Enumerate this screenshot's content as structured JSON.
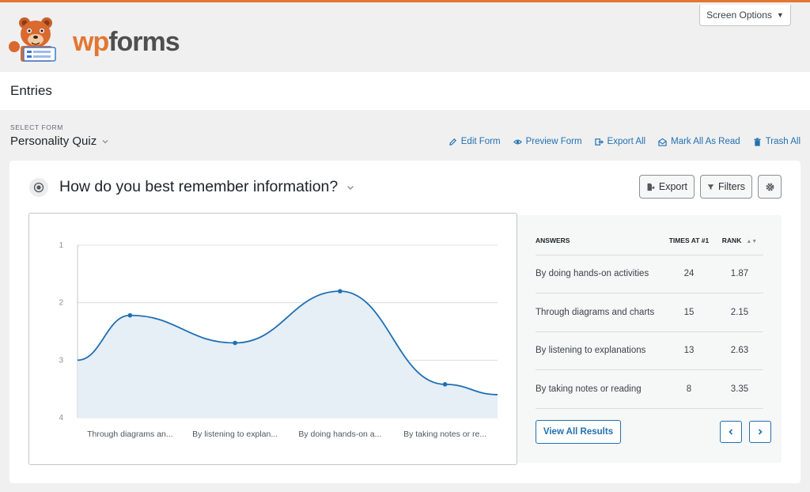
{
  "brand": {
    "wp": "wp",
    "forms": "forms",
    "accent": "#e27730"
  },
  "screen_options": {
    "label": "Screen Options",
    "caret": "▼"
  },
  "page": {
    "title": "Entries"
  },
  "select_form": {
    "label": "SELECT FORM",
    "value": "Personality Quiz"
  },
  "actions": [
    {
      "label": "Edit Form",
      "icon": "pencil-icon"
    },
    {
      "label": "Preview Form",
      "icon": "eye-icon"
    },
    {
      "label": "Export All",
      "icon": "export-icon"
    },
    {
      "label": "Mark All As Read",
      "icon": "envelope-open-icon"
    },
    {
      "label": "Trash All",
      "icon": "trash-icon"
    }
  ],
  "question": {
    "title": "How do you best remember information?"
  },
  "toolbar": {
    "export": "Export",
    "filters": "Filters"
  },
  "chart_data": {
    "type": "area",
    "categories": [
      "Through diagrams an...",
      "By listening to explan...",
      "By doing hands-on a...",
      "By taking notes or re..."
    ],
    "values": [
      2.22,
      2.7,
      1.8,
      3.42
    ],
    "start_value": 3.0,
    "end_value": 3.6,
    "y_ticks": [
      "1",
      "2",
      "3",
      "4"
    ],
    "ylim": [
      1,
      4
    ],
    "y_reversed": true,
    "grid": true,
    "line_color": "#1f6fb3",
    "fill_color": "#e6eef6"
  },
  "results": {
    "headers": {
      "answers": "ANSWERS",
      "times": "TIMES AT #1",
      "rank": "RANK"
    },
    "rows": [
      {
        "answer": "By doing hands-on activities",
        "times": "24",
        "rank": "1.87"
      },
      {
        "answer": "Through diagrams and charts",
        "times": "15",
        "rank": "2.15"
      },
      {
        "answer": "By listening to explanations",
        "times": "13",
        "rank": "2.63"
      },
      {
        "answer": "By taking notes or reading",
        "times": "8",
        "rank": "3.35"
      }
    ],
    "view_all": "View All Results"
  }
}
